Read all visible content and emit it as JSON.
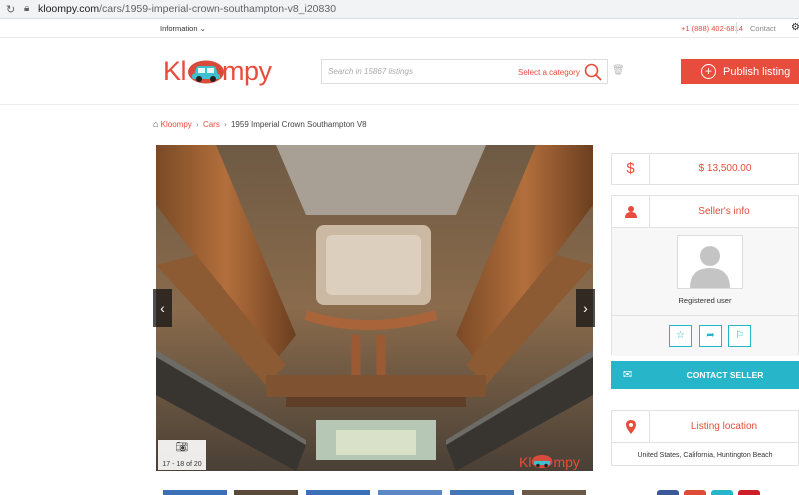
{
  "browser": {
    "url_domain": "kloompy.com",
    "url_path": "/cars/1959-imperial-crown-southampton-v8_i20830"
  },
  "topbar": {
    "information_label": "Information",
    "phone": "+1 (888) 402-6814",
    "contact_label": "Contact"
  },
  "header": {
    "logo_text_left": "Kl",
    "logo_text_right": "mpy",
    "search_placeholder": "Search in 15867 listings",
    "category_label": "Select a category",
    "publish_label": "Publish listing"
  },
  "breadcrumb": {
    "items": [
      "Kloompy",
      "Cars",
      "1959 Imperial Crown Southampton V8"
    ]
  },
  "gallery": {
    "counter": "17 - 18 of 20",
    "watermark_left": "Kl",
    "watermark_right": "mpy"
  },
  "sidebar": {
    "price": "$ 13,500.00",
    "seller_title": "Seller's info",
    "seller_role": "Registered user",
    "contact_label": "CONTACT SELLER",
    "location_title": "Listing location",
    "location_value": "United States, California, Huntington Beach"
  },
  "colors": {
    "brand": "#e74c3c",
    "accent": "#26b5c9"
  },
  "icons": {
    "price": "dollar-icon",
    "seller": "user-icon",
    "favorite": "star-icon",
    "share": "share-icon",
    "report": "flag-icon",
    "contact": "envelope-icon",
    "location": "map-marker-icon"
  }
}
